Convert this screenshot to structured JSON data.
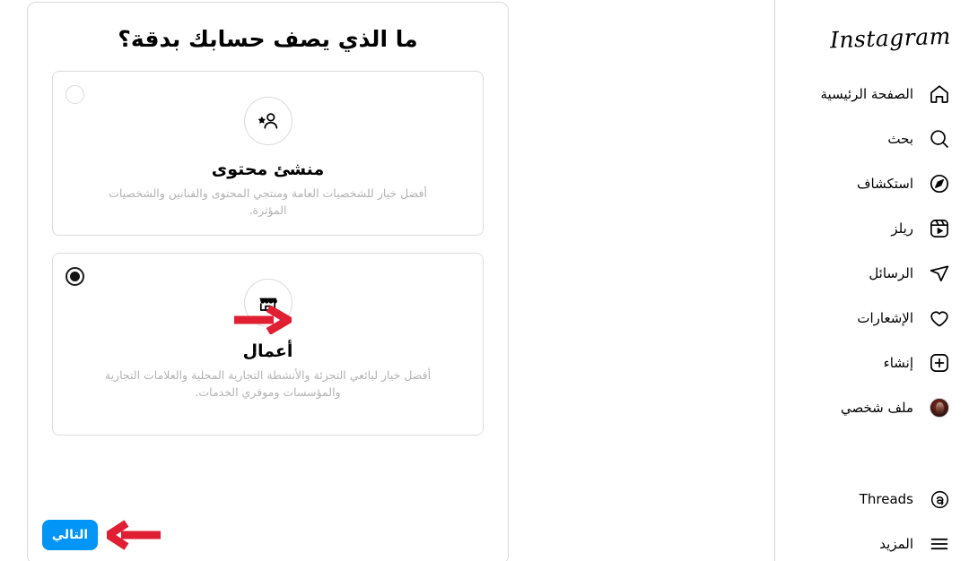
{
  "page": {
    "title": "ما الذي يصف حسابك بدقة؟",
    "direction": "rtl",
    "accent_color": "#0095f6",
    "arrow_color": "#e01f32"
  },
  "options": [
    {
      "id": "creator",
      "icon": "creator-star-person-icon",
      "title": "منشئ محتوى",
      "description": "أفضل خيار للشخصيات العامة ومنتجي المحتوى والفنانين والشخصيات المؤثرة.",
      "selected": false
    },
    {
      "id": "business",
      "icon": "storefront-icon",
      "title": "أعمال",
      "description": "أفضل خيار لبائعي التجزئة والأنشطة التجارية المحلية والعلامات التجارية والمؤسسات وموفري الخدمات.",
      "selected": true
    }
  ],
  "footer": {
    "next_label": "التالي"
  },
  "sidebar": {
    "brand": "Instagram",
    "items": [
      {
        "icon": "home-icon",
        "label": "الصفحة الرئيسية"
      },
      {
        "icon": "search-icon",
        "label": "بحث"
      },
      {
        "icon": "compass-icon",
        "label": "استكشاف"
      },
      {
        "icon": "reels-icon",
        "label": "ريلز"
      },
      {
        "icon": "paper-plane-icon",
        "label": "الرسائل"
      },
      {
        "icon": "heart-icon",
        "label": "الإشعارات"
      },
      {
        "icon": "plus-square-icon",
        "label": "إنشاء"
      },
      {
        "icon": "avatar",
        "label": "ملف شخصي"
      }
    ],
    "bottom_items": [
      {
        "icon": "threads-icon",
        "label": "Threads"
      },
      {
        "icon": "hamburger-icon",
        "label": "المزيد"
      }
    ]
  }
}
